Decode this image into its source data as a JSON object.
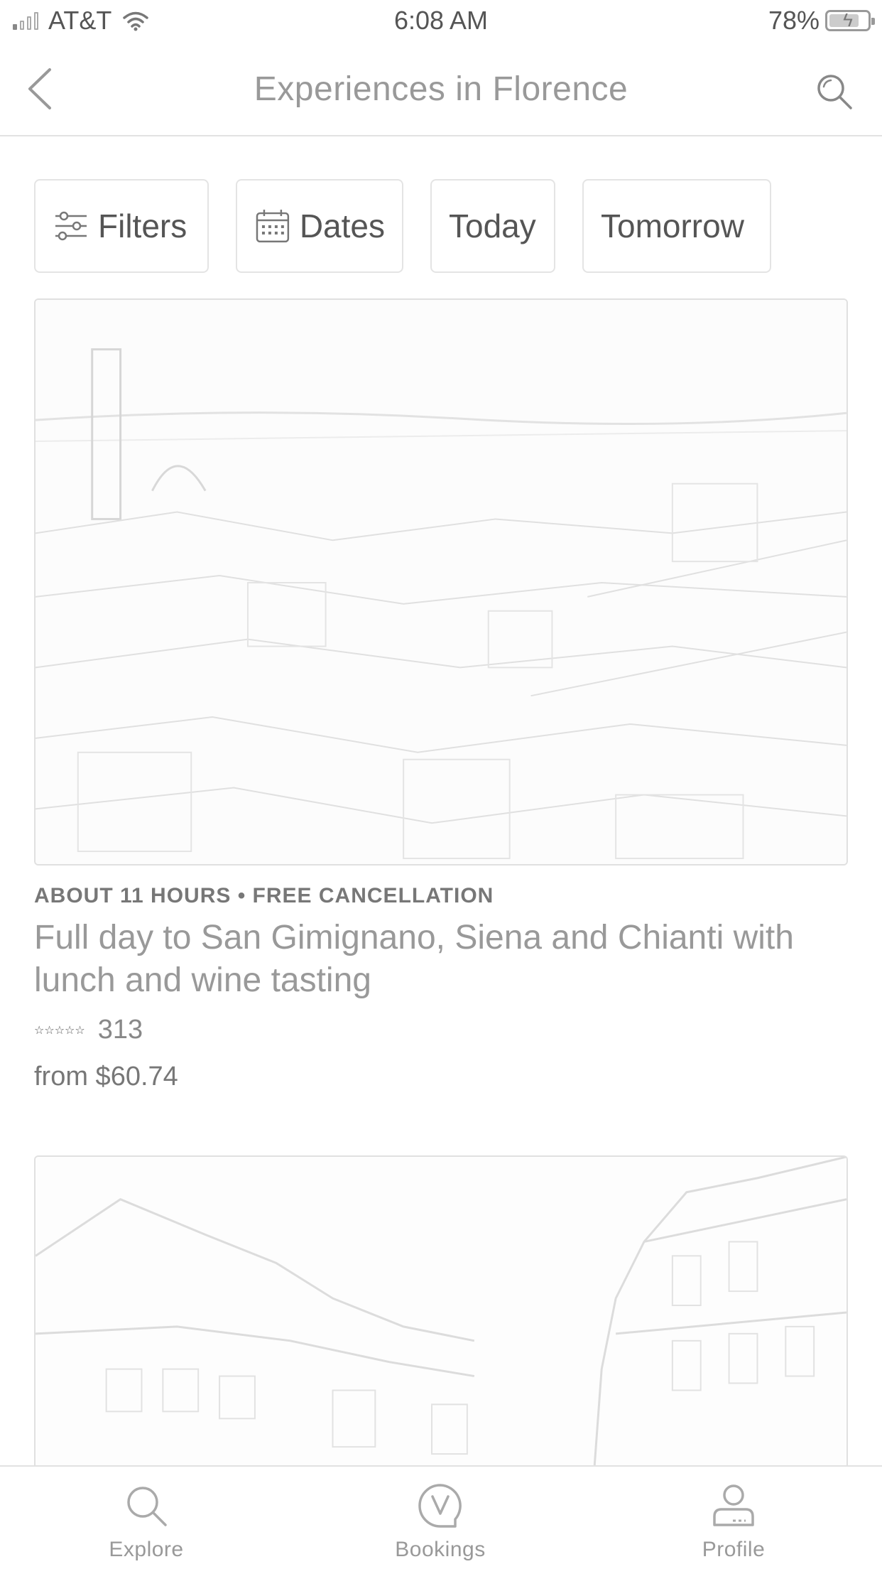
{
  "status_bar": {
    "carrier": "AT&T",
    "time": "6:08 AM",
    "battery": "78%",
    "battery_level": 0.78
  },
  "nav": {
    "title": "Experiences in Florence"
  },
  "filters": {
    "chips": [
      {
        "label": "Filters",
        "icon": "sliders-icon"
      },
      {
        "label": "Dates",
        "icon": "calendar-icon"
      },
      {
        "label": "Today"
      },
      {
        "label": "Tomorrow"
      }
    ]
  },
  "listings": [
    {
      "meta": "ABOUT 11 HOURS • FREE CANCELLATION",
      "title": "Full day to San Gimignano, Siena and Chianti with lunch and wine tasting",
      "stars": "☆☆☆☆☆",
      "review_count": "313",
      "price": "from $60.74"
    }
  ],
  "tab_bar": {
    "tabs": [
      {
        "label": "Explore",
        "icon": "search-icon"
      },
      {
        "label": "Bookings",
        "icon": "bookings-icon"
      },
      {
        "label": "Profile",
        "icon": "profile-icon"
      }
    ]
  }
}
